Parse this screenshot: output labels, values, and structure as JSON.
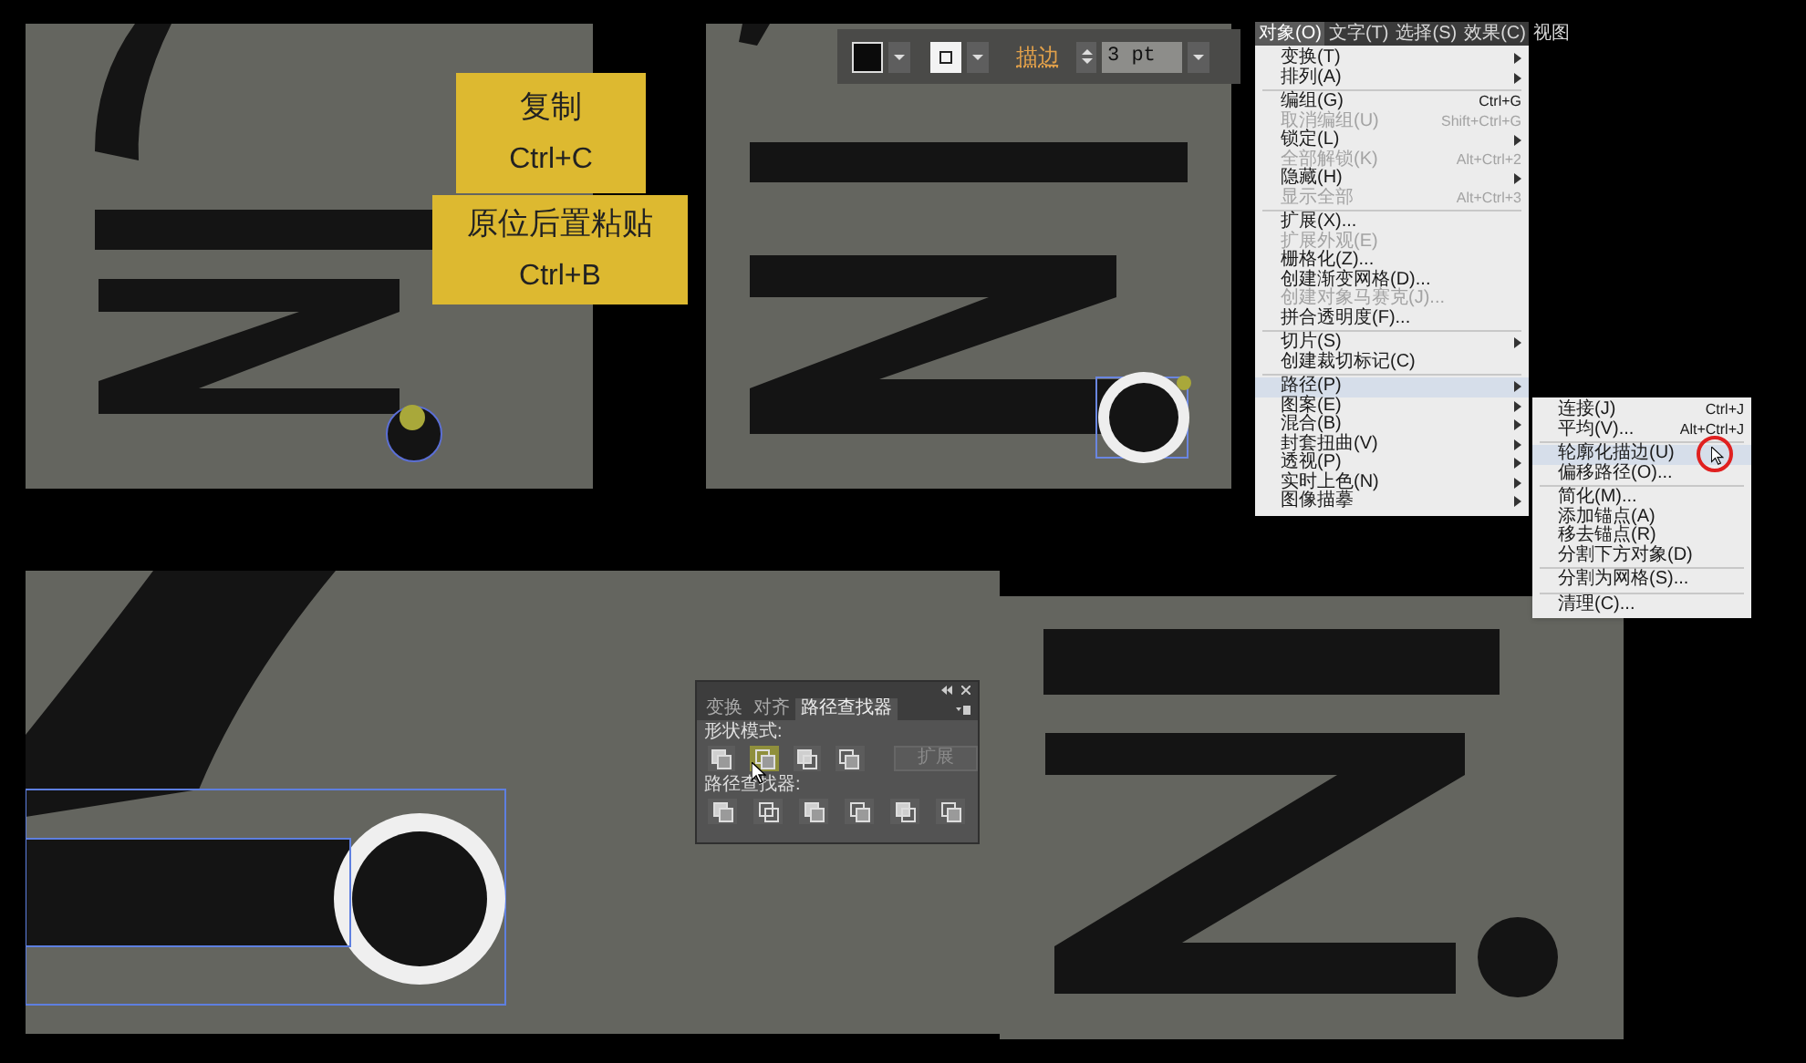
{
  "copy_card": {
    "title": "复制",
    "shortcut": "Ctrl+C"
  },
  "paste_card": {
    "title": "原位后置粘贴",
    "shortcut": "Ctrl+B"
  },
  "toolbar": {
    "stroke_label": "描边",
    "stroke_weight": "3 pt"
  },
  "object_menu": {
    "menubar": [
      {
        "label": "对象(O)",
        "selected": true
      },
      {
        "label": "文字(T)",
        "selected": false
      },
      {
        "label": "选择(S)",
        "selected": false
      },
      {
        "label": "效果(C)",
        "selected": false
      },
      {
        "label": "视图",
        "selected": false
      }
    ],
    "items": [
      {
        "kind": "item",
        "label": "变换(T)",
        "submenu": true,
        "disabled": false,
        "selected": false
      },
      {
        "kind": "item",
        "label": "排列(A)",
        "submenu": true,
        "disabled": false,
        "selected": false
      },
      {
        "kind": "separator"
      },
      {
        "kind": "item",
        "label": "编组(G)",
        "shortcut": "Ctrl+G",
        "submenu": false,
        "disabled": false,
        "selected": false
      },
      {
        "kind": "item",
        "label": "取消编组(U)",
        "shortcut": "Shift+Ctrl+G",
        "submenu": false,
        "disabled": true,
        "selected": false
      },
      {
        "kind": "item",
        "label": "锁定(L)",
        "submenu": true,
        "disabled": false,
        "selected": false
      },
      {
        "kind": "item",
        "label": "全部解锁(K)",
        "shortcut": "Alt+Ctrl+2",
        "submenu": false,
        "disabled": true,
        "selected": false
      },
      {
        "kind": "item",
        "label": "隐藏(H)",
        "submenu": true,
        "disabled": false,
        "selected": false
      },
      {
        "kind": "item",
        "label": "显示全部",
        "shortcut": "Alt+Ctrl+3",
        "submenu": false,
        "disabled": true,
        "selected": false
      },
      {
        "kind": "separator"
      },
      {
        "kind": "item",
        "label": "扩展(X)...",
        "submenu": false,
        "disabled": false,
        "selected": false
      },
      {
        "kind": "item",
        "label": "扩展外观(E)",
        "submenu": false,
        "disabled": true,
        "selected": false
      },
      {
        "kind": "item",
        "label": "栅格化(Z)...",
        "submenu": false,
        "disabled": false,
        "selected": false
      },
      {
        "kind": "item",
        "label": "创建渐变网格(D)...",
        "submenu": false,
        "disabled": false,
        "selected": false
      },
      {
        "kind": "item",
        "label": "创建对象马赛克(J)...",
        "submenu": false,
        "disabled": true,
        "selected": false
      },
      {
        "kind": "item",
        "label": "拼合透明度(F)...",
        "submenu": false,
        "disabled": false,
        "selected": false
      },
      {
        "kind": "separator"
      },
      {
        "kind": "item",
        "label": "切片(S)",
        "submenu": true,
        "disabled": false,
        "selected": false
      },
      {
        "kind": "item",
        "label": "创建裁切标记(C)",
        "submenu": false,
        "disabled": false,
        "selected": false
      },
      {
        "kind": "separator"
      },
      {
        "kind": "item",
        "label": "路径(P)",
        "submenu": true,
        "disabled": false,
        "selected": true
      },
      {
        "kind": "item",
        "label": "图案(E)",
        "submenu": true,
        "disabled": false,
        "selected": false
      },
      {
        "kind": "item",
        "label": "混合(B)",
        "submenu": true,
        "disabled": false,
        "selected": false
      },
      {
        "kind": "item",
        "label": "封套扭曲(V)",
        "submenu": true,
        "disabled": false,
        "selected": false
      },
      {
        "kind": "item",
        "label": "透视(P)",
        "submenu": true,
        "disabled": false,
        "selected": false
      },
      {
        "kind": "item",
        "label": "实时上色(N)",
        "submenu": true,
        "disabled": false,
        "selected": false
      },
      {
        "kind": "item",
        "label": "图像描摹",
        "submenu": true,
        "disabled": false,
        "selected": false
      }
    ]
  },
  "path_submenu": {
    "items": [
      {
        "kind": "item",
        "label": "连接(J)",
        "shortcut": "Ctrl+J",
        "submenu": false,
        "disabled": false,
        "selected": false
      },
      {
        "kind": "item",
        "label": "平均(V)...",
        "shortcut": "Alt+Ctrl+J",
        "submenu": false,
        "disabled": false,
        "selected": false
      },
      {
        "kind": "separator"
      },
      {
        "kind": "item",
        "label": "轮廓化描边(U)",
        "submenu": false,
        "disabled": false,
        "selected": true
      },
      {
        "kind": "item",
        "label": "偏移路径(O)...",
        "submenu": false,
        "disabled": false,
        "selected": false
      },
      {
        "kind": "separator"
      },
      {
        "kind": "item",
        "label": "简化(M)...",
        "submenu": false,
        "disabled": false,
        "selected": false
      },
      {
        "kind": "item",
        "label": "添加锚点(A)",
        "submenu": false,
        "disabled": false,
        "selected": false
      },
      {
        "kind": "item",
        "label": "移去锚点(R)",
        "submenu": false,
        "disabled": false,
        "selected": false
      },
      {
        "kind": "item",
        "label": "分割下方对象(D)",
        "submenu": false,
        "disabled": false,
        "selected": false
      },
      {
        "kind": "separator"
      },
      {
        "kind": "item",
        "label": "分割为网格(S)...",
        "submenu": false,
        "disabled": false,
        "selected": false
      },
      {
        "kind": "separator"
      },
      {
        "kind": "item",
        "label": "清理(C)...",
        "submenu": false,
        "disabled": false,
        "selected": false
      }
    ]
  },
  "pathfinder_panel": {
    "tabs": [
      {
        "label": "变换",
        "selected": false
      },
      {
        "label": "对齐",
        "selected": false
      },
      {
        "label": "路径查找器",
        "selected": true
      }
    ],
    "shape_modes_label": "形状模式:",
    "expand_button": {
      "label": "扩展",
      "disabled": true
    },
    "pathfinders_label": "路径查找器:"
  }
}
